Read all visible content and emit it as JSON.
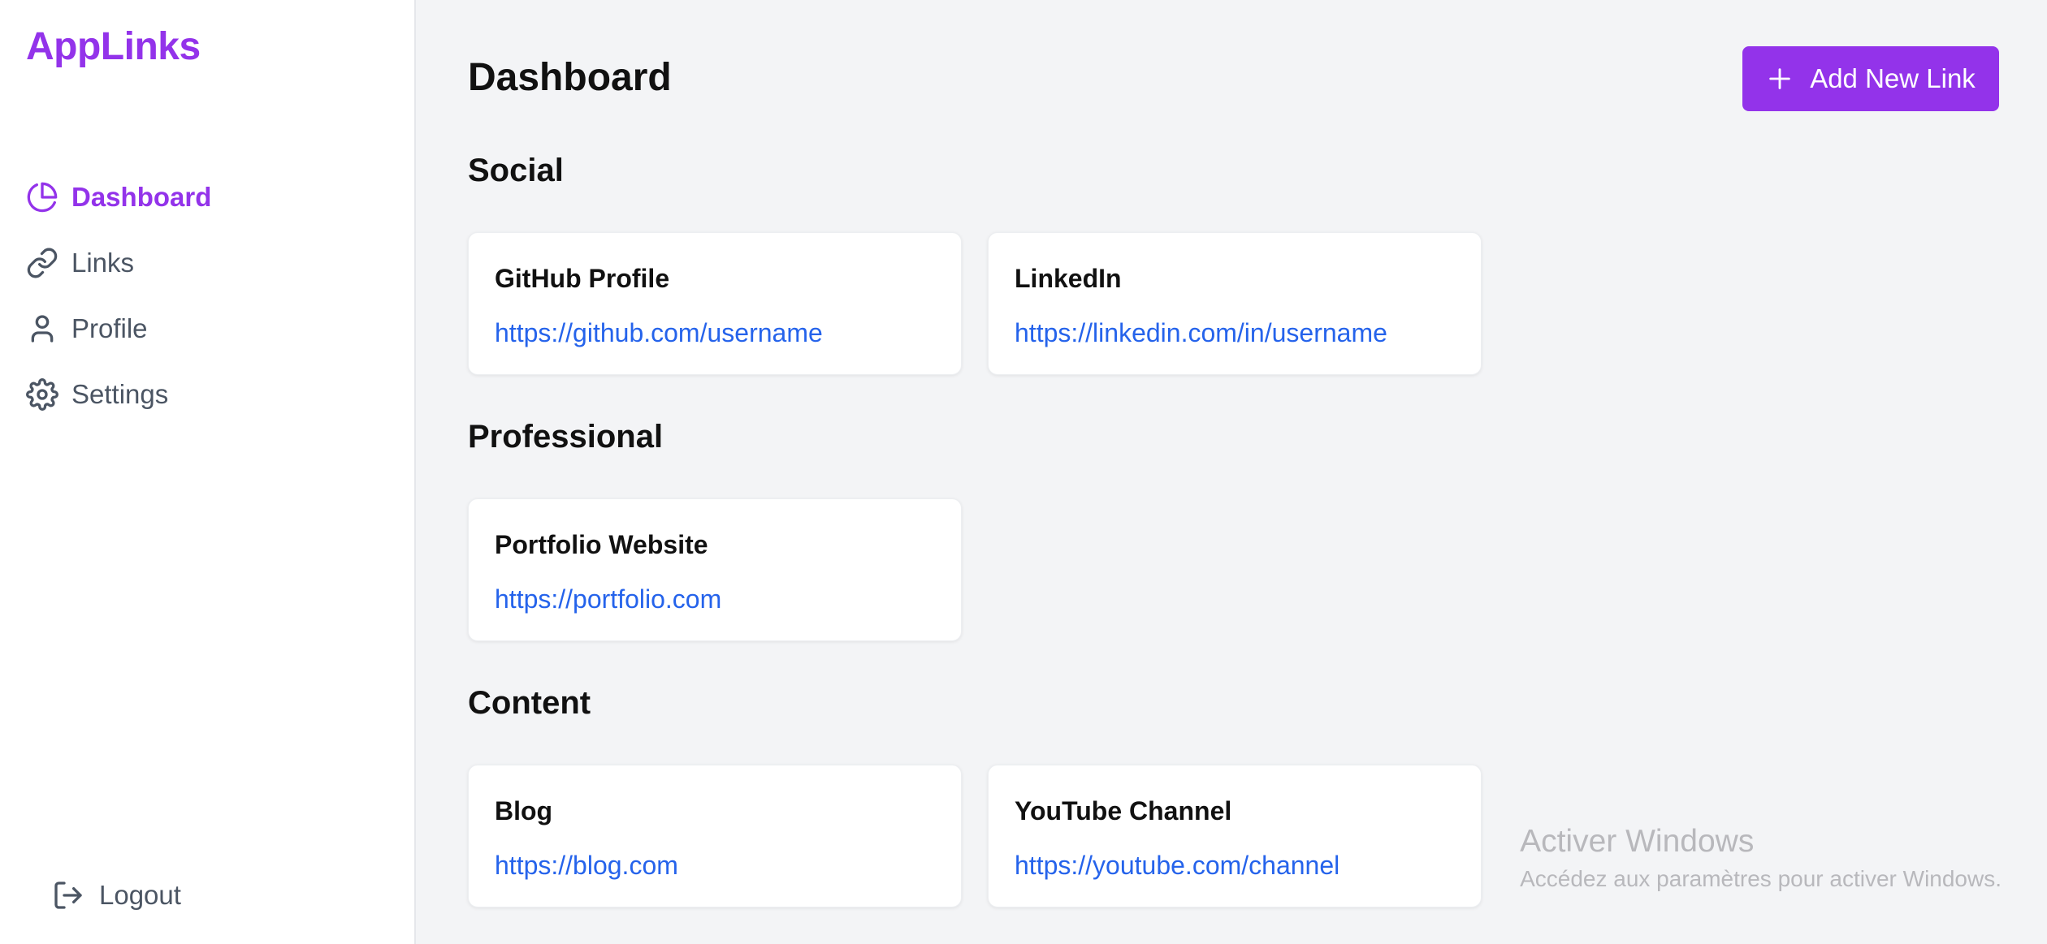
{
  "app": {
    "brand": "AppLinks",
    "accent_color": "#9333ea",
    "link_color": "#2563eb"
  },
  "sidebar": {
    "items": [
      {
        "label": "Dashboard",
        "icon": "pie-chart-icon",
        "active": true
      },
      {
        "label": "Links",
        "icon": "link-icon",
        "active": false
      },
      {
        "label": "Profile",
        "icon": "user-icon",
        "active": false
      },
      {
        "label": "Settings",
        "icon": "gear-icon",
        "active": false
      }
    ],
    "logout_label": "Logout"
  },
  "header": {
    "title": "Dashboard",
    "add_button_label": "Add New Link"
  },
  "sections": [
    {
      "title": "Social",
      "links": [
        {
          "title": "GitHub Profile",
          "url": "https://github.com/username"
        },
        {
          "title": "LinkedIn",
          "url": "https://linkedin.com/in/username"
        }
      ]
    },
    {
      "title": "Professional",
      "links": [
        {
          "title": "Portfolio Website",
          "url": "https://portfolio.com"
        }
      ]
    },
    {
      "title": "Content",
      "links": [
        {
          "title": "Blog",
          "url": "https://blog.com"
        },
        {
          "title": "YouTube Channel",
          "url": "https://youtube.com/channel"
        }
      ]
    }
  ],
  "watermark": {
    "title": "Activer Windows",
    "subtitle": "Accédez aux paramètres pour activer Windows."
  }
}
